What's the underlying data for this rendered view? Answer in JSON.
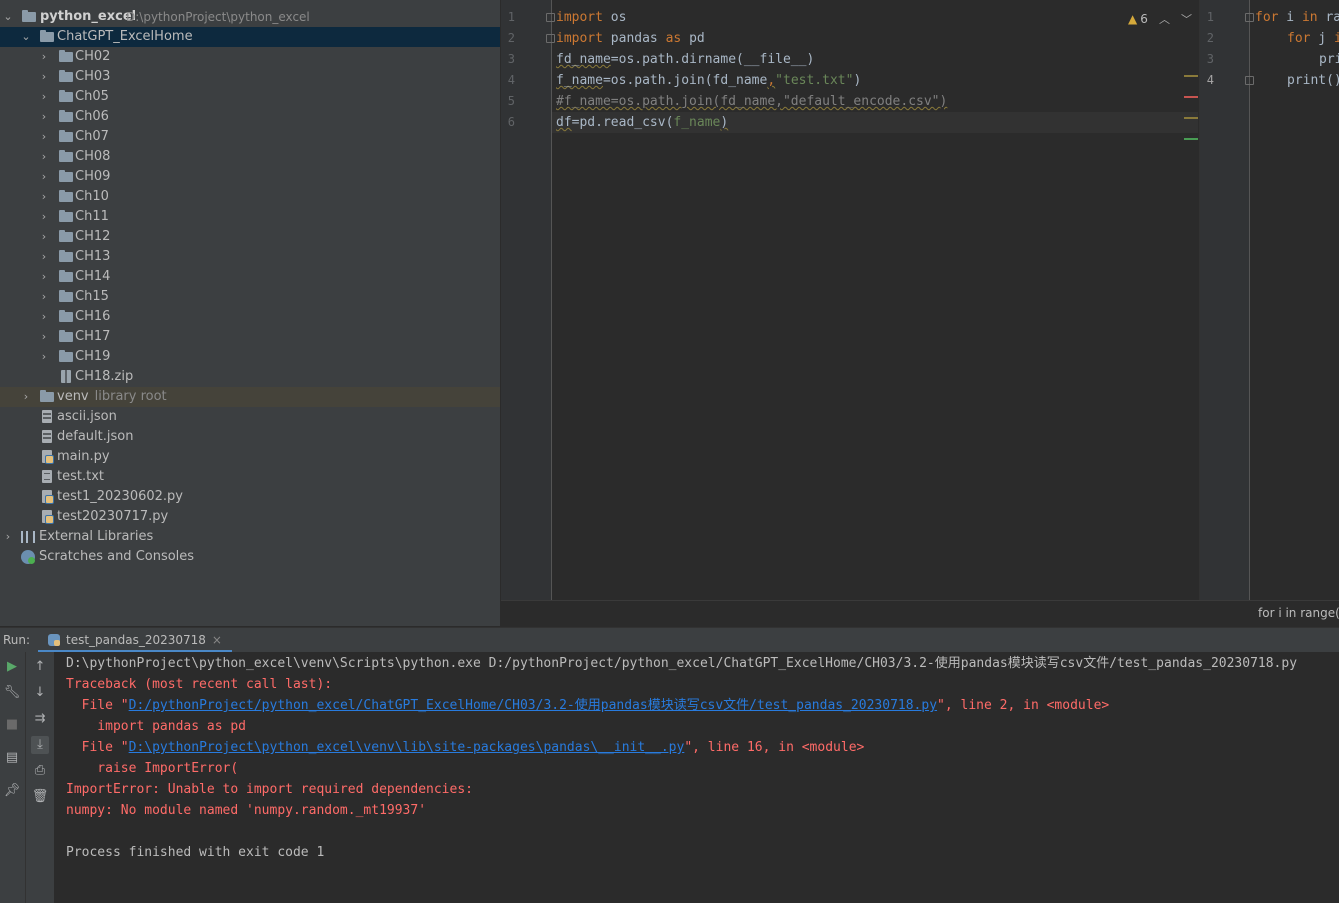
{
  "project_tree": {
    "root": {
      "name": "python_excel",
      "path": "D:\\pythonProject\\python_excel"
    },
    "home": {
      "name": "ChatGPT_ExcelHome"
    },
    "folders": [
      "CH02",
      "CH03",
      "Ch05",
      "Ch06",
      "Ch07",
      "CH08",
      "CH09",
      "Ch10",
      "Ch11",
      "CH12",
      "CH13",
      "CH14",
      "Ch15",
      "CH16",
      "CH17",
      "CH19"
    ],
    "zip_file": "CH18.zip",
    "venv": {
      "name": "venv",
      "hint": "library root"
    },
    "root_files": [
      {
        "name": "ascii.json",
        "icon": "json-file-icon"
      },
      {
        "name": "default.json",
        "icon": "json-file-icon"
      },
      {
        "name": "main.py",
        "icon": "python-file-icon"
      },
      {
        "name": "test.txt",
        "icon": "text-file-icon"
      },
      {
        "name": "test1_20230602.py",
        "icon": "python-file-icon"
      },
      {
        "name": "test20230717.py",
        "icon": "python-file-icon"
      }
    ],
    "external_libraries": "External Libraries",
    "scratches": "Scratches and Consoles"
  },
  "editor": {
    "line_numbers": [
      "1",
      "2",
      "3",
      "4",
      "5",
      "6"
    ],
    "tokens": {
      "l1_kw": "import",
      "l1_rest": " os",
      "l2_kw": "import",
      "l2_mod": " pandas ",
      "l2_as": "as",
      "l2_alias": " pd",
      "l3_var": "fd_name",
      "l3_rest": "=os.path.dirname(__file__)",
      "l4_var": "f_name",
      "l4_mid": "=os.path.join(fd_name",
      "l4_comma": ",",
      "l4_str": "\"test.txt\"",
      "l4_end": ")",
      "l5_cmt": "#f_name=os.path.join(fd_name,\"default_encode.csv\")",
      "l6_var": "df",
      "l6_mid": "=pd.read_csv(",
      "l6_arg": "f_name",
      "l6_end": ")"
    },
    "warning_count": "6"
  },
  "editor2": {
    "line_numbers": [
      "1",
      "2",
      "3",
      "4"
    ],
    "l1_kw": "for",
    "l1_var": " i ",
    "l1_in": "in",
    "l1_rest": " ra",
    "l2_kw": "for",
    "l2_var": " j ",
    "l2_in": "i",
    "l3": "pri",
    "l4": "print()",
    "breadcrumb": "for i in range("
  },
  "run_panel": {
    "label": "Run:",
    "tab": "test_pandas_20230718",
    "console": {
      "cmd": "D:\\pythonProject\\python_excel\\venv\\Scripts\\python.exe D:/pythonProject/python_excel/ChatGPT_ExcelHome/CH03/3.2-使用pandas模块读写csv文件/test_pandas_20230718.py",
      "traceback": "Traceback (most recent call last):",
      "file1_prefix": "  File \"",
      "file1_link": "D:/pythonProject/python_excel/ChatGPT_ExcelHome/CH03/3.2-使用pandas模块读写csv文件/test_pandas_20230718.py",
      "file1_suffix": "\", line 2, in <module>",
      "code1": "    import pandas as pd",
      "file2_prefix": "  File \"",
      "file2_link": "D:\\pythonProject\\python_excel\\venv\\lib\\site-packages\\pandas\\__init__.py",
      "file2_suffix": "\", line 16, in <module>",
      "code2": "    raise ImportError(",
      "error1": "ImportError: Unable to import required dependencies:",
      "error2": "numpy: No module named 'numpy.random._mt19937'",
      "exit": "Process finished with exit code 1"
    }
  },
  "colors": {
    "keyword": "#cc7832",
    "string": "#6a8759",
    "comment": "#808080",
    "error": "#ff6b68",
    "link": "#287bde",
    "selection": "#0d293e"
  }
}
